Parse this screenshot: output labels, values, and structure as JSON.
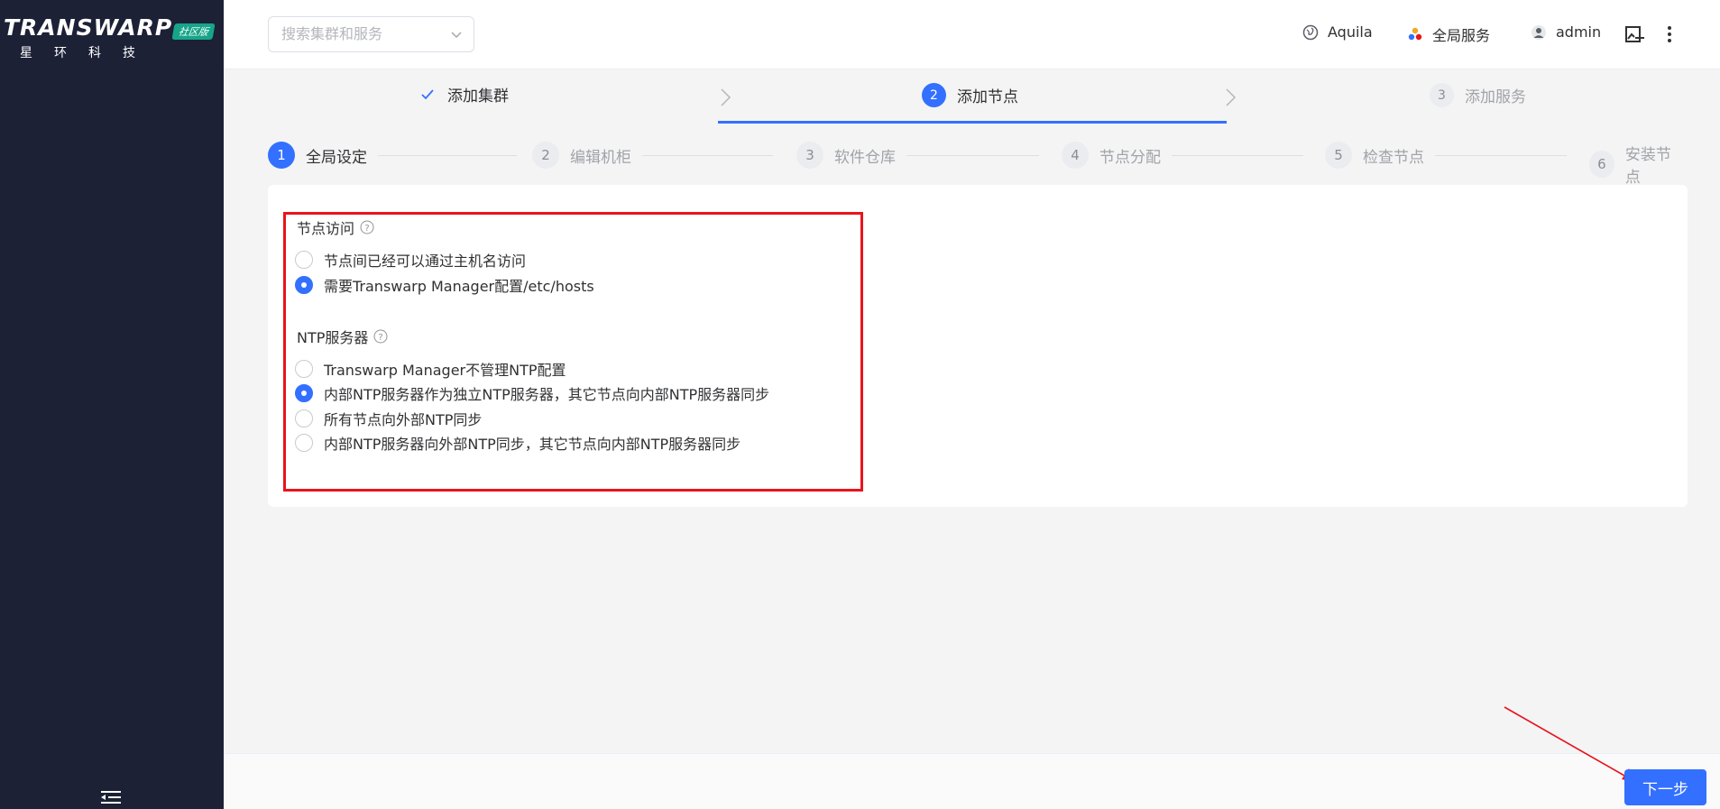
{
  "brand": {
    "logo_text": "TRANSWARP",
    "logo_badge": "社区版",
    "logo_sub": "星环科技"
  },
  "topbar": {
    "search_placeholder": "搜索集群和服务",
    "items": [
      {
        "label": "Aquila",
        "icon": "globe-icon"
      },
      {
        "label": "全局服务",
        "icon": "dots-icon"
      },
      {
        "label": "admin",
        "icon": "user-icon"
      }
    ]
  },
  "main_steps": [
    {
      "label": "添加集群",
      "state": "done"
    },
    {
      "number": "2",
      "label": "添加节点",
      "state": "active"
    },
    {
      "number": "3",
      "label": "添加服务",
      "state": "idle"
    }
  ],
  "sub_steps": [
    {
      "number": "1",
      "label": "全局设定",
      "state": "active"
    },
    {
      "number": "2",
      "label": "编辑机柜",
      "state": "idle"
    },
    {
      "number": "3",
      "label": "软件仓库",
      "state": "idle"
    },
    {
      "number": "4",
      "label": "节点分配",
      "state": "idle"
    },
    {
      "number": "5",
      "label": "检查节点",
      "state": "idle"
    },
    {
      "number": "6",
      "label": "安装节点",
      "state": "idle"
    }
  ],
  "node_access": {
    "title": "节点访问",
    "options": [
      {
        "label": "节点间已经可以通过主机名访问",
        "checked": false
      },
      {
        "label": "需要Transwarp Manager配置/etc/hosts",
        "checked": true
      }
    ]
  },
  "ntp": {
    "title": "NTP服务器",
    "options": [
      {
        "label": "Transwarp Manager不管理NTP配置",
        "checked": false
      },
      {
        "label": "内部NTP服务器作为独立NTP服务器，其它节点向内部NTP服务器同步",
        "checked": true
      },
      {
        "label": "所有节点向外部NTP同步",
        "checked": false
      },
      {
        "label": "内部NTP服务器向外部NTP同步，其它节点向内部NTP服务器同步",
        "checked": false
      }
    ]
  },
  "footer": {
    "next_label": "下一步"
  },
  "colors": {
    "primary": "#3370ff",
    "sidebar": "#1c2136",
    "annotation_red": "#e8141d"
  }
}
